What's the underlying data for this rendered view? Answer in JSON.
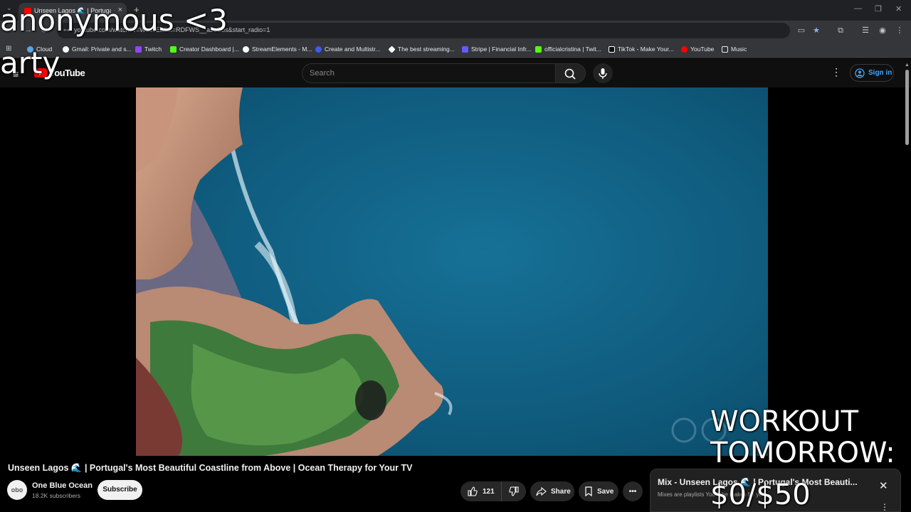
{
  "browser": {
    "tab_title": "Unseen Lagos 🌊 | Portugal's M",
    "new_tab_glyph": "+",
    "url": "youtube.com/watch?v=WsdvE&list=RDFWS__aJcGbs&start_radio=1",
    "bookmarks": [
      {
        "label": "Cloud",
        "color": "#5ba4e6"
      },
      {
        "label": "Gmail: Private and s...",
        "color": "#ea4335"
      },
      {
        "label": "Twitch",
        "color": "#9146ff"
      },
      {
        "label": "Creator Dashboard |...",
        "color": "#53fc18"
      },
      {
        "label": "StreamElements - M...",
        "color": "#ffffff"
      },
      {
        "label": "Create and Multistr...",
        "color": "#3d5afe"
      },
      {
        "label": "The best streaming...",
        "color": "#ffffff"
      },
      {
        "label": "Stripe | Financial Infr...",
        "color": "#635bff"
      },
      {
        "label": "officialcristina | Twit...",
        "color": "#53fc18"
      },
      {
        "label": "TikTok - Make Your...",
        "color": "#ffffff"
      },
      {
        "label": "YouTube",
        "color": "#ff0000"
      },
      {
        "label": "Music",
        "color": "#e8eaed"
      }
    ]
  },
  "youtube": {
    "logo_text": "YouTube",
    "search_placeholder": "Search",
    "sign_in_label": "Sign in"
  },
  "video": {
    "title": "Unseen Lagos 🌊 | Portugal's Most Beautiful Coastline from Above | Ocean Therapy for Your TV",
    "channel_initials": "obo",
    "channel_name": "One Blue Ocean",
    "subscribers": "18.2K subscribers",
    "subscribe_label": "Subscribe",
    "likes": "121",
    "share_label": "Share",
    "save_label": "Save"
  },
  "mix": {
    "title": "Mix - Unseen Lagos 🌊 | Portugal's Most Beauti...",
    "subtitle": "Mixes are playlists YouTube makes for you"
  },
  "stream_overlays": {
    "viewer": "anonymous <3",
    "name": "arty",
    "goal_line1": "WORKOUT",
    "goal_line2": "TOMORROW:",
    "goal_progress": "$0/$50"
  },
  "colors": {
    "accent_red": "#ff0000",
    "link_blue": "#3ea6ff",
    "ocean_deep": "#0e4f6e"
  }
}
